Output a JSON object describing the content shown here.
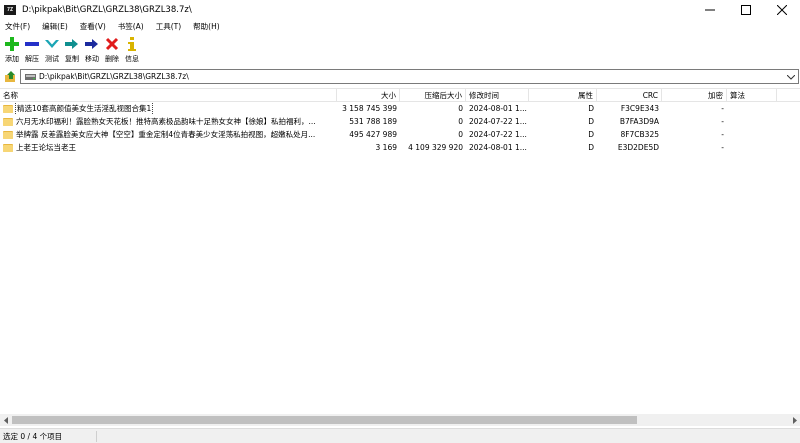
{
  "window": {
    "title": "D:\\pikpak\\Bit\\GRZL\\GRZL38\\GRZL38.7z\\",
    "app_icon_text": "7Z"
  },
  "menu": [
    "文件(F)",
    "编辑(E)",
    "查看(V)",
    "书签(A)",
    "工具(T)",
    "帮助(H)"
  ],
  "toolbar": [
    {
      "label": "添加",
      "icon": "add-icon",
      "color": "#1db81d"
    },
    {
      "label": "解压",
      "icon": "extract-icon",
      "color": "#2430c8"
    },
    {
      "label": "测试",
      "icon": "test-icon",
      "color": "#1aa5b5"
    },
    {
      "label": "复制",
      "icon": "copy-icon",
      "color": "#0f8f8f"
    },
    {
      "label": "移动",
      "icon": "move-icon",
      "color": "#1b2a9e"
    },
    {
      "label": "删除",
      "icon": "delete-icon",
      "color": "#e01b1b"
    },
    {
      "label": "信息",
      "icon": "info-icon",
      "color": "#d9b400"
    }
  ],
  "address": {
    "path": "D:\\pikpak\\Bit\\GRZL\\GRZL38\\GRZL38.7z\\"
  },
  "columns": {
    "name": "名称",
    "size": "大小",
    "packed": "压缩后大小",
    "modified": "修改时间",
    "attr": "属性",
    "crc": "CRC",
    "encrypted": "加密",
    "method": "算法"
  },
  "rows": [
    {
      "name": "精选10套高颜值美女生活淫乱视图合集1",
      "size": "3 158 745 399",
      "packed": "0",
      "modified": "2024-08-01 1...",
      "attr": "D",
      "crc": "F3C9E343",
      "encrypted": "-",
      "method": ""
    },
    {
      "name": "六月无水印福利！露脸熟女天花板！推特高素极品韵味十足熟女女神【徐娘】私拍福利，...",
      "size": "531 788 189",
      "packed": "0",
      "modified": "2024-07-22 1...",
      "attr": "D",
      "crc": "B7FA3D9A",
      "encrypted": "-",
      "method": ""
    },
    {
      "name": "举牌露 反差露脸美女应大神【空空】重金定制4位青春美少女淫荡私拍视图，超嫩私处月...",
      "size": "495 427 989",
      "packed": "0",
      "modified": "2024-07-22 1...",
      "attr": "D",
      "crc": "8F7CB325",
      "encrypted": "-",
      "method": ""
    },
    {
      "name": "上老王论坛当老王",
      "size": "3 169",
      "packed": "4 109 329 920",
      "modified": "2024-08-01 1...",
      "attr": "D",
      "crc": "E3D2DE5D",
      "encrypted": "-",
      "method": ""
    }
  ],
  "status": {
    "selection": "选定 0 / 4 个项目"
  }
}
